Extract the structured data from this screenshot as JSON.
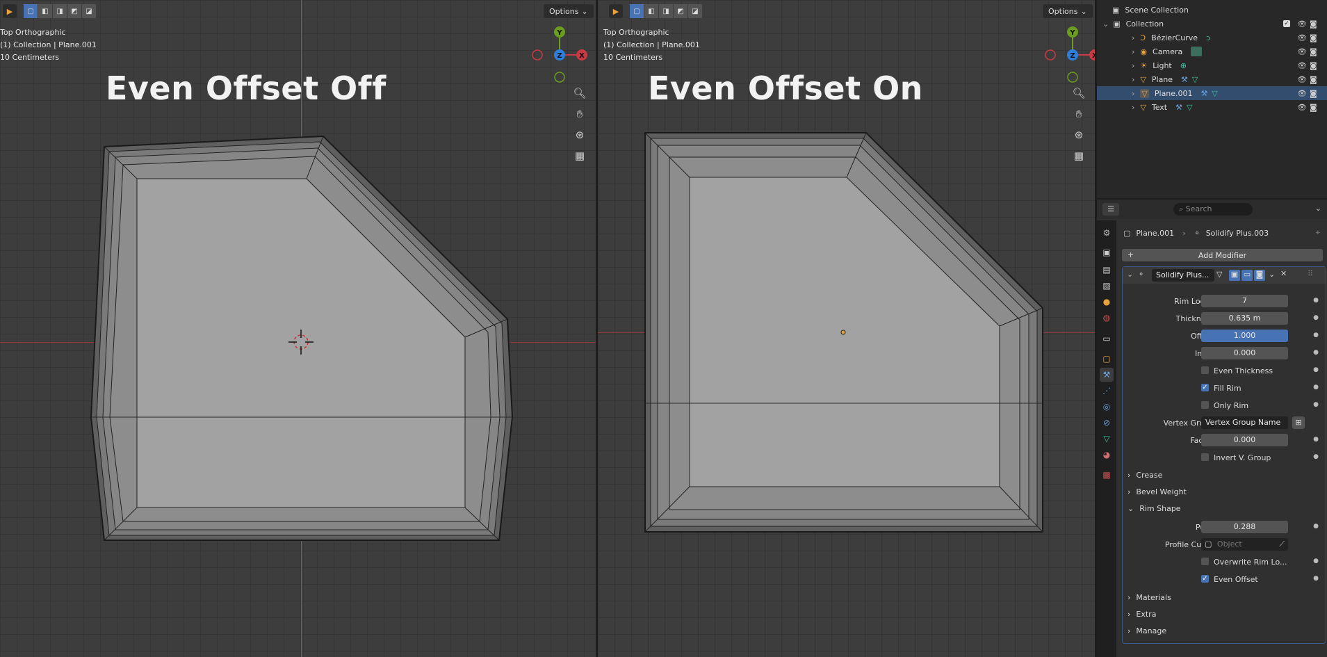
{
  "viewport_left": {
    "options_label": "Options",
    "view_name": "Top Orthographic",
    "collection_line": "(1) Collection | Plane.001",
    "scale_line": "10 Centimeters",
    "title": "Even Offset Off"
  },
  "viewport_right": {
    "options_label": "Options",
    "view_name": "Top Orthographic",
    "collection_line": "(1) Collection | Plane.001",
    "scale_line": "10 Centimeters",
    "title": "Even Offset On"
  },
  "gizmo": {
    "y": "Y",
    "z": "Z",
    "x": "X"
  },
  "outliner": {
    "root": "Scene Collection",
    "collection": "Collection",
    "items": [
      {
        "name": "BézierCurve",
        "icon": "curve-icon",
        "color": "#e8a23c"
      },
      {
        "name": "Camera",
        "icon": "camera-icon",
        "color": "#e8a23c"
      },
      {
        "name": "Light",
        "icon": "light-icon",
        "color": "#e8a23c"
      },
      {
        "name": "Plane",
        "icon": "mesh-icon",
        "color": "#e8a23c"
      },
      {
        "name": "Plane.001",
        "icon": "mesh-icon",
        "color": "#e8a23c"
      },
      {
        "name": "Text",
        "icon": "text-icon",
        "color": "#e8a23c"
      }
    ]
  },
  "properties": {
    "search_placeholder": "Search",
    "breadcrumb_object": "Plane.001",
    "breadcrumb_modifier": "Solidify Plus.003",
    "add_modifier": "Add Modifier",
    "modifier_name": "Solidify Plus...",
    "fields": {
      "rim_loops": {
        "label": "Rim Loops",
        "value": "7"
      },
      "thickness": {
        "label": "Thickness",
        "value": "0.635 m"
      },
      "offset": {
        "label": "Offset",
        "value": "1.000"
      },
      "inset": {
        "label": "Inset",
        "value": "0.000"
      },
      "even_thickness": {
        "label": "Even Thickness",
        "checked": false
      },
      "fill_rim": {
        "label": "Fill Rim",
        "checked": true
      },
      "only_rim": {
        "label": "Only Rim",
        "checked": false
      },
      "vertex_group": {
        "label": "Vertex Group",
        "value": "Vertex Group Name"
      },
      "factor": {
        "label": "Factor",
        "value": "0.000"
      },
      "invert_v_group": {
        "label": "Invert V. Group",
        "checked": false
      },
      "crease": "Crease",
      "bevel_weight": "Bevel Weight",
      "rim_shape": "Rim Shape",
      "push": {
        "label": "Push",
        "value": "0.288"
      },
      "profile_curve": {
        "label": "Profile Curve",
        "placeholder": "Object"
      },
      "overwrite_rim": {
        "label": "Overwrite Rim Lo...",
        "checked": false
      },
      "even_offset": {
        "label": "Even Offset",
        "checked": true
      },
      "materials": "Materials",
      "extra": "Extra",
      "manage": "Manage"
    }
  },
  "colors": {
    "accent_blue": "#4772b3",
    "x_axis": "#c93a44",
    "y_axis": "#6a9c1f",
    "z_axis": "#2d7fdb"
  }
}
